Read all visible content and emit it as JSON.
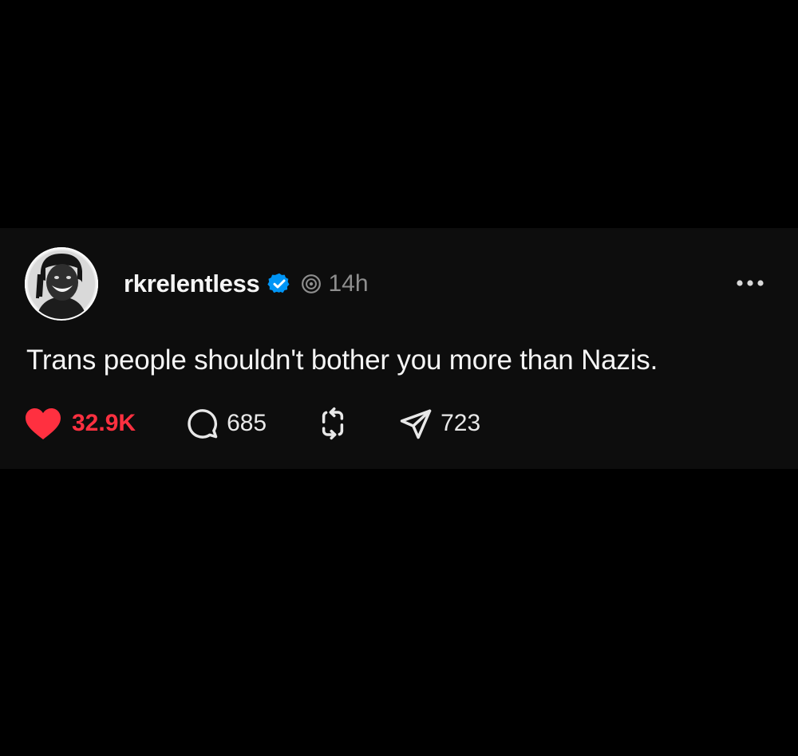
{
  "post": {
    "username": "rkrelentless",
    "timestamp": "14h",
    "text": "Trans people shouldn't bother you more than Nazis.",
    "likes": "32.9K",
    "comments": "685",
    "shares": "723"
  },
  "icons": {
    "verified": "verified-badge-icon",
    "threads": "threads-logo-icon",
    "more": "more-options-icon",
    "like": "heart-icon",
    "comment": "comment-bubble-icon",
    "repost": "repost-icon",
    "share": "send-icon"
  },
  "colors": {
    "background": "#000000",
    "card": "#0d0d0d",
    "like_active": "#ff3040",
    "verified_blue": "#0095f6",
    "muted_text": "#8e8e8e"
  }
}
